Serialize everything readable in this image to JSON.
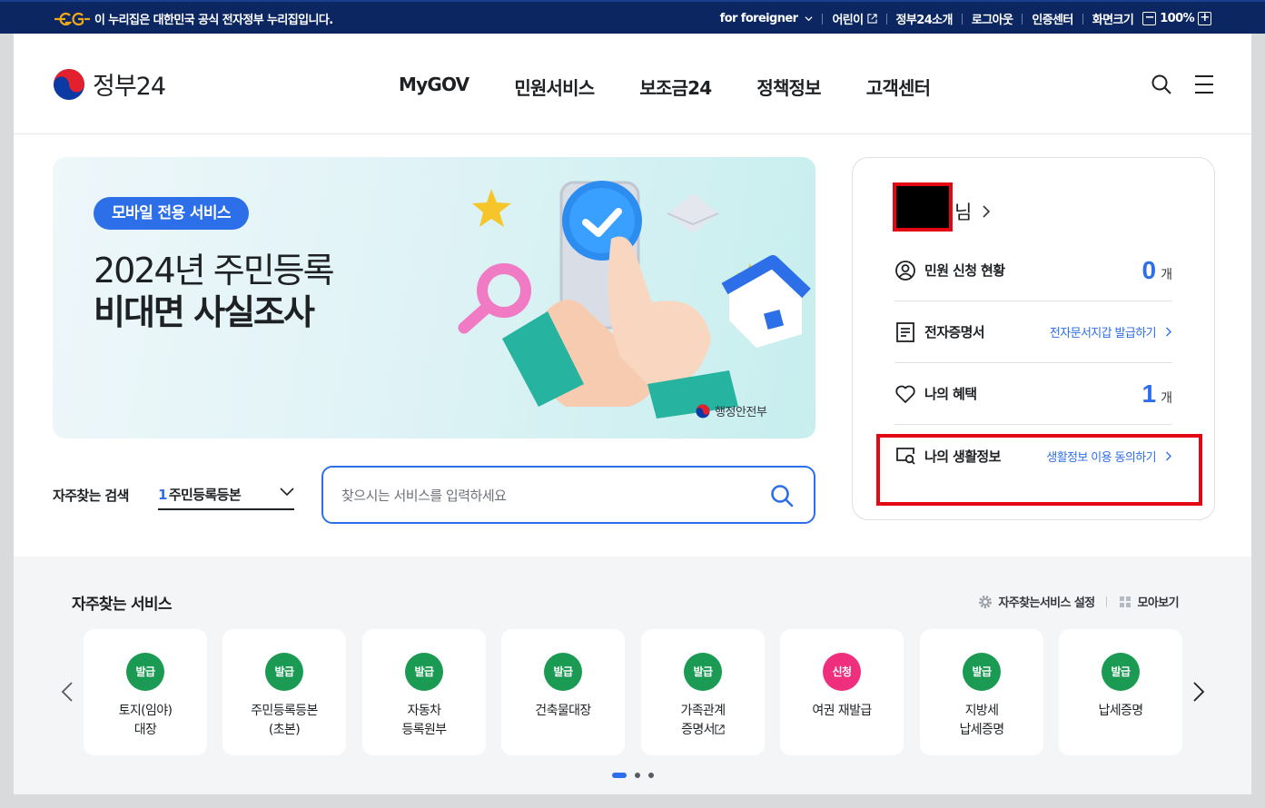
{
  "topbar": {
    "notice": "이 누리집은 대한민국 공식 전자정부 누리집입니다.",
    "links": {
      "foreigner": "for foreigner",
      "kids": "어린이",
      "intro": "정부24소개",
      "logout": "로그아웃",
      "cert": "인증센터",
      "zoom_label": "화면크기",
      "zoom_minus": "−",
      "zoom_value": "100%",
      "zoom_plus": "+"
    }
  },
  "header": {
    "logo_text": "정부24",
    "nav": [
      "MyGOV",
      "민원서비스",
      "보조금24",
      "정책정보",
      "고객센터"
    ]
  },
  "banner": {
    "tag": "모바일 전용 서비스",
    "line1": "2024년 주민등록",
    "line2": "비대면 사실조사",
    "ministry": "행정안전부"
  },
  "quick_search": {
    "label": "자주찾는 검색",
    "select_num": "1",
    "select_text": "주민등록등본",
    "placeholder": "찾으시는 서비스를 입력하세요"
  },
  "user_card": {
    "suffix": "님",
    "rows": {
      "applications": {
        "label": "민원 신청 현황",
        "count": "0",
        "unit": "개"
      },
      "edocs": {
        "label": "전자증명서",
        "link": "전자문서지갑 발급하기"
      },
      "benefits": {
        "label": "나의 혜택",
        "count": "1",
        "unit": "개"
      },
      "lifeinfo": {
        "label": "나의 생활정보",
        "link": "생활정보 이용 동의하기"
      }
    }
  },
  "frequent": {
    "title": "자주찾는 서비스",
    "settings": "자주찾는서비스 설정",
    "viewall": "모아보기",
    "cards": [
      {
        "badge": "발급",
        "l1": "토지(임야)",
        "l2": "대장"
      },
      {
        "badge": "발급",
        "l1": "주민등록등본",
        "l2": "(초본)"
      },
      {
        "badge": "발급",
        "l1": "자동차",
        "l2": "등록원부"
      },
      {
        "badge": "발급",
        "l1": "건축물대장",
        "l2": ""
      },
      {
        "badge": "발급",
        "l1": "가족관계",
        "l2": "증명서"
      },
      {
        "badge": "신청",
        "l1": "여권 재발급",
        "l2": ""
      },
      {
        "badge": "발급",
        "l1": "지방세",
        "l2": "납세증명"
      },
      {
        "badge": "발급",
        "l1": "납세증명",
        "l2": ""
      }
    ]
  },
  "colors": {
    "primary": "#2d6ee9",
    "navy": "#0b2660",
    "issue_green": "#1a9a52",
    "apply_pink": "#ef2f7e",
    "annotation_red": "#e30613"
  }
}
